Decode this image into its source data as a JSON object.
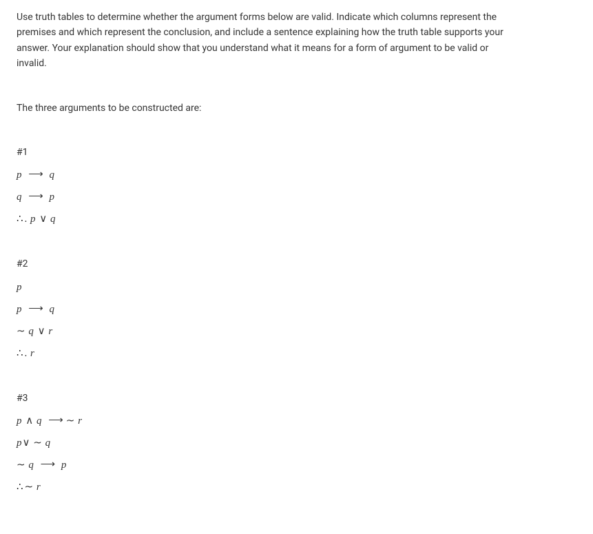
{
  "instructions": "Use truth tables to determine whether the argument forms below are valid. Indicate which columns represent the premises and which represent the conclusion, and include a sentence explaining how the truth table supports your answer. Your explanation should show that you understand what it means for a form of argument to be valid or invalid.",
  "subheading": "The three arguments to be constructed are:",
  "problems": {
    "p1": {
      "label": "#1",
      "lines": {
        "l1": {
          "var1": "p",
          "arrow": "⟶",
          "var2": "q"
        },
        "l2": {
          "var1": "q",
          "arrow": "⟶",
          "var2": "p"
        },
        "l3": {
          "therefore": "∴",
          "period": ".",
          "var1": "p",
          "vee": "∨",
          "var2": "q"
        }
      }
    },
    "p2": {
      "label": "#2",
      "lines": {
        "l1": {
          "var1": "p"
        },
        "l2": {
          "var1": "p",
          "arrow": "⟶",
          "var2": "q"
        },
        "l3": {
          "tilde": "∼",
          "var1": "q",
          "vee": "∨",
          "var2": "r"
        },
        "l4": {
          "therefore": "∴",
          "period": ".",
          "var1": "r"
        }
      }
    },
    "p3": {
      "label": "#3",
      "lines": {
        "l1": {
          "var1": "p",
          "wedge": "∧",
          "var2": "q",
          "arrow": "⟶",
          "tilde": "∼",
          "var3": "r"
        },
        "l2": {
          "var1": "p",
          "vee": "∨",
          "tilde": "∼",
          "var2": "q"
        },
        "l3": {
          "tilde": "∼",
          "var1": "q",
          "arrow": "⟶",
          "var2": "p"
        },
        "l4": {
          "therefore": "∴",
          "tilde": "∼",
          "var1": "r"
        }
      }
    }
  }
}
